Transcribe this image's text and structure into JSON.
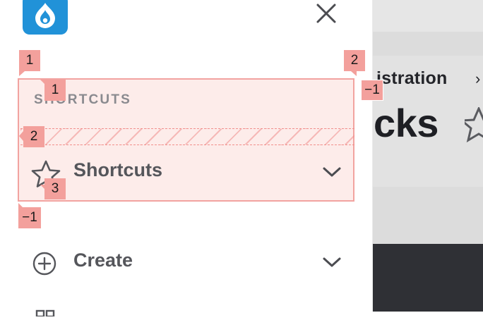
{
  "sidebar": {
    "section_heading": "SHORTCUTS",
    "items": [
      {
        "label": "Shortcuts",
        "icon": "star-icon"
      },
      {
        "label": "Create",
        "icon": "plus-circle-icon"
      }
    ]
  },
  "background_page": {
    "breadcrumb": "istration",
    "breadcrumb_separator": "›",
    "title": "cks"
  },
  "annotations": {
    "badges": [
      "1",
      "2",
      "1",
      "−1",
      "2",
      "3",
      "−1"
    ]
  },
  "colors": {
    "brand": "#2192d8",
    "highlight_fill": "#fdecea",
    "highlight_border": "#f2a3a0",
    "badge": "#f3a09c",
    "dark_panel": "#2f3035"
  }
}
